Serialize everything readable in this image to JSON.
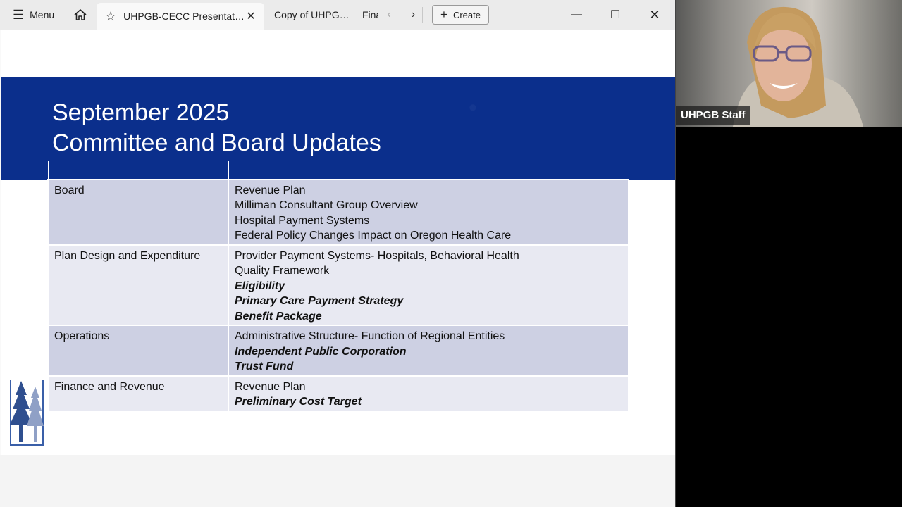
{
  "titlebar": {
    "menu_label": "Menu",
    "tabs": [
      {
        "label": "UHPGB-CECC Presentat…",
        "active": true
      },
      {
        "label": "Copy of UHPG…"
      },
      {
        "label": "Fina"
      }
    ],
    "create_label": "Create"
  },
  "slide": {
    "title_line1": "September 2025",
    "title_line2": "Committee and Board Updates",
    "rows": [
      {
        "committee": "Board",
        "items": [
          "Revenue Plan",
          "Milliman Consultant Group Overview",
          "Hospital Payment Systems",
          "Federal Policy Changes Impact on Oregon Health Care"
        ]
      },
      {
        "committee": "Plan Design and Expenditure",
        "items": [
          "Provider Payment Systems- Hospitals, Behavioral Health",
          "Quality Framework",
          "Eligibility",
          "Primary Care Payment Strategy",
          "Benefit Package"
        ]
      },
      {
        "committee": "Operations",
        "items": [
          "Administrative Structure- Function of Regional Entities",
          "Independent Public Corporation",
          "Trust Fund"
        ]
      },
      {
        "committee": "Finance and Revenue",
        "items": [
          "Revenue Plan",
          "Preliminary Cost Target"
        ]
      }
    ]
  },
  "video": {
    "participant_name": "UHPGB Staff"
  },
  "colors": {
    "banner": "#0b2f8c",
    "row_dark": "#cdd0e3",
    "row_light": "#e8e9f2"
  }
}
